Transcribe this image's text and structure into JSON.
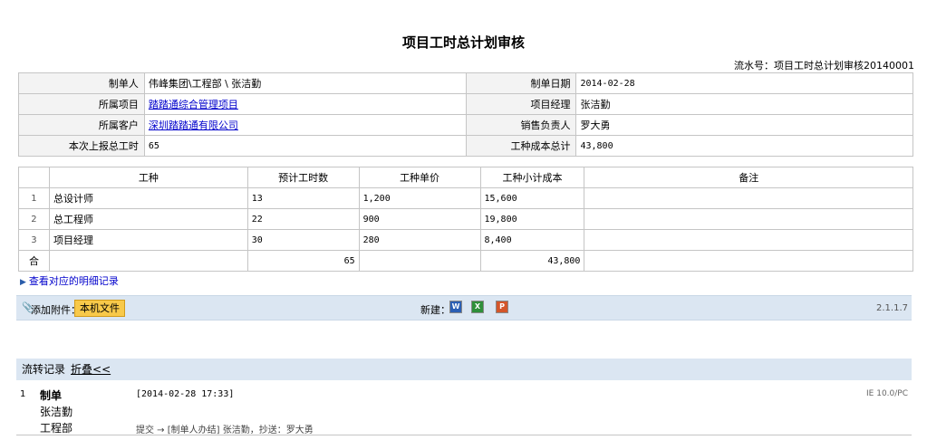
{
  "page": {
    "title": "项目工时总计划审核",
    "serial_label": "流水号：项目工时总计划审核20140001"
  },
  "info": {
    "creator_label": "制单人",
    "creator_value": "伟峰集团\\工程部 \\ 张洁勤",
    "date_label": "制单日期",
    "date_value": "2014-02-28",
    "project_label": "所属项目",
    "project_value": "踏踏通综合管理项目",
    "pm_label": "项目经理",
    "pm_value": "张洁勤",
    "customer_label": "所属客户",
    "customer_value": "深圳踏踏通有限公司",
    "sales_label": "销售负责人",
    "sales_value": "罗大勇",
    "hours_label": "本次上报总工时",
    "hours_value": "65",
    "cost_label": "工种成本总计",
    "cost_value": "43,800"
  },
  "detail": {
    "headers": [
      "工种",
      "预计工时数",
      "工种单价",
      "工种小计成本",
      "备注"
    ],
    "rows": [
      {
        "idx": "1",
        "type": "总设计师",
        "hours": "13",
        "price": "1,200",
        "subtotal": "15,600",
        "note": ""
      },
      {
        "idx": "2",
        "type": "总工程师",
        "hours": "22",
        "price": "900",
        "subtotal": "19,800",
        "note": ""
      },
      {
        "idx": "3",
        "type": "项目经理",
        "hours": "30",
        "price": "280",
        "subtotal": "8,400",
        "note": ""
      }
    ],
    "total_label": "合",
    "total_hours": "65",
    "total_cost": "43,800"
  },
  "view_link": "查看对应的明细记录",
  "attach": {
    "label": "添加附件：",
    "button": "本机文件",
    "new_label": "新建：",
    "icons": [
      "word-icon",
      "excel-icon",
      "powerpoint-icon"
    ],
    "version": "2.1.1.7"
  },
  "flow": {
    "title": "流转记录",
    "fold": "折叠<<",
    "records": [
      {
        "no": "1",
        "action": "制单",
        "user": "张洁勤",
        "dept": "工程部",
        "time": "[2014-02-28 17:33]",
        "note": "提交 → [制单人办结] 张洁勤，抄送：罗大勇",
        "browser": "IE 10.0/PC"
      }
    ]
  },
  "colors": {
    "bar_bg": "#dbe6f2",
    "label_bg": "#f3f3f3",
    "link": "#0000cc",
    "button": "#f8c94a"
  }
}
